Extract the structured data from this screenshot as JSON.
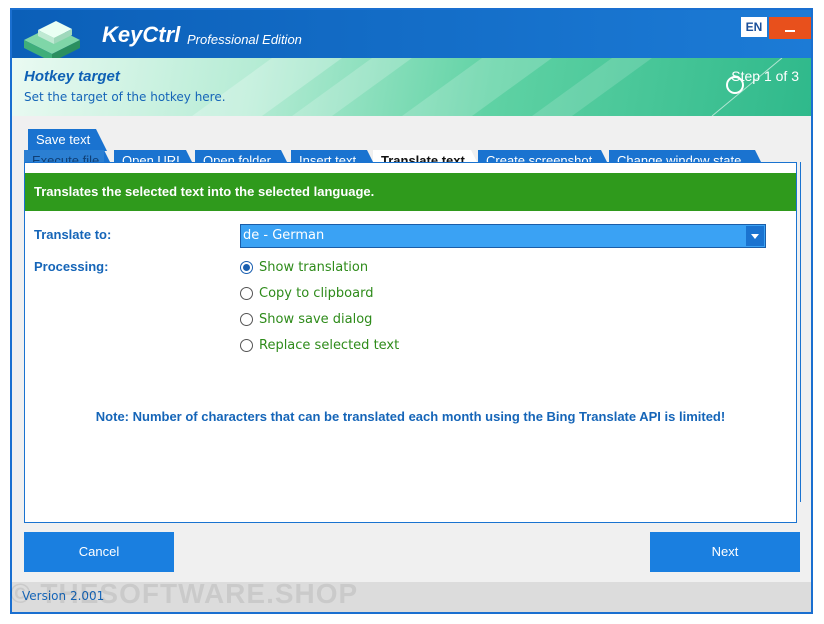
{
  "app": {
    "name": "KeyCtrl",
    "edition": "Professional Edition",
    "language_button": "EN"
  },
  "banner": {
    "title": "Hotkey target",
    "subtitle": "Set the target of the hotkey here.",
    "step": "Step 1 of 3"
  },
  "tabs": {
    "top": [
      {
        "label": "Save text"
      }
    ],
    "row": [
      {
        "label": "Execute file"
      },
      {
        "label": "Open URL"
      },
      {
        "label": "Open folder"
      },
      {
        "label": "Insert text"
      },
      {
        "label": "Translate text",
        "active": true
      },
      {
        "label": "Create screenshot"
      },
      {
        "label": "Change window state"
      }
    ]
  },
  "panel": {
    "description": "Translates the selected text into the selected language.",
    "translate_to_label": "Translate to:",
    "translate_to_value": "de - German",
    "processing_label": "Processing:",
    "processing_options": [
      {
        "label": "Show translation",
        "checked": true
      },
      {
        "label": "Copy to clipboard",
        "checked": false
      },
      {
        "label": "Show save dialog",
        "checked": false
      },
      {
        "label": "Replace selected text",
        "checked": false
      }
    ],
    "note": "Note: Number of characters that can be translated each month using the Bing Translate API is limited!"
  },
  "buttons": {
    "cancel": "Cancel",
    "next": "Next"
  },
  "footer": {
    "version": "Version 2.001",
    "watermark": "© THESOFTWARE.SHOP"
  },
  "colors": {
    "accent": "#1a7fe0",
    "header": "#0b5fb8",
    "description_bar": "#2f9a1c",
    "option_text": "#2e8b1a",
    "minimize": "#e8501c"
  }
}
